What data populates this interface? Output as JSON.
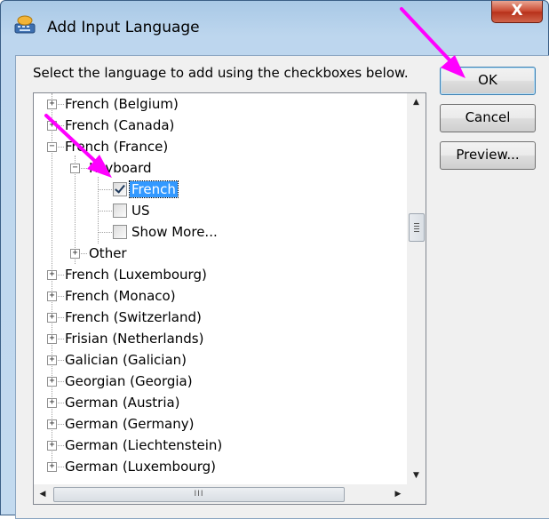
{
  "window": {
    "title": "Add Input Language",
    "close_label": "X"
  },
  "dialog": {
    "prompt": "Select the language to add using the checkboxes below.",
    "ok_label": "OK",
    "cancel_label": "Cancel",
    "preview_label": "Preview..."
  },
  "tree": {
    "items": [
      {
        "label": "French (Belgium)",
        "expander": "+"
      },
      {
        "label": "French (Canada)",
        "expander": "+"
      },
      {
        "label": "French (France)",
        "expander": "−"
      },
      {
        "label": "Keyboard",
        "expander": "−"
      },
      {
        "label": "French",
        "checked": true,
        "selected": true
      },
      {
        "label": "US",
        "checked": false
      },
      {
        "label": "Show More...",
        "checked": false
      },
      {
        "label": "Other",
        "expander": "+"
      },
      {
        "label": "French (Luxembourg)",
        "expander": "+"
      },
      {
        "label": "French (Monaco)",
        "expander": "+"
      },
      {
        "label": "French (Switzerland)",
        "expander": "+"
      },
      {
        "label": "Frisian (Netherlands)",
        "expander": "+"
      },
      {
        "label": "Galician (Galician)",
        "expander": "+"
      },
      {
        "label": "Georgian (Georgia)",
        "expander": "+"
      },
      {
        "label": "German (Austria)",
        "expander": "+"
      },
      {
        "label": "German (Germany)",
        "expander": "+"
      },
      {
        "label": "German (Liechtenstein)",
        "expander": "+"
      },
      {
        "label": "German (Luxembourg)",
        "expander": "+"
      }
    ]
  },
  "scrollbars": {
    "vertical_up": "▲",
    "vertical_down": "▼",
    "horizontal_left": "◀",
    "horizontal_right": "▶",
    "horizontal_grip": "III"
  },
  "annotations": {
    "arrow_color": "#ff00ff"
  }
}
